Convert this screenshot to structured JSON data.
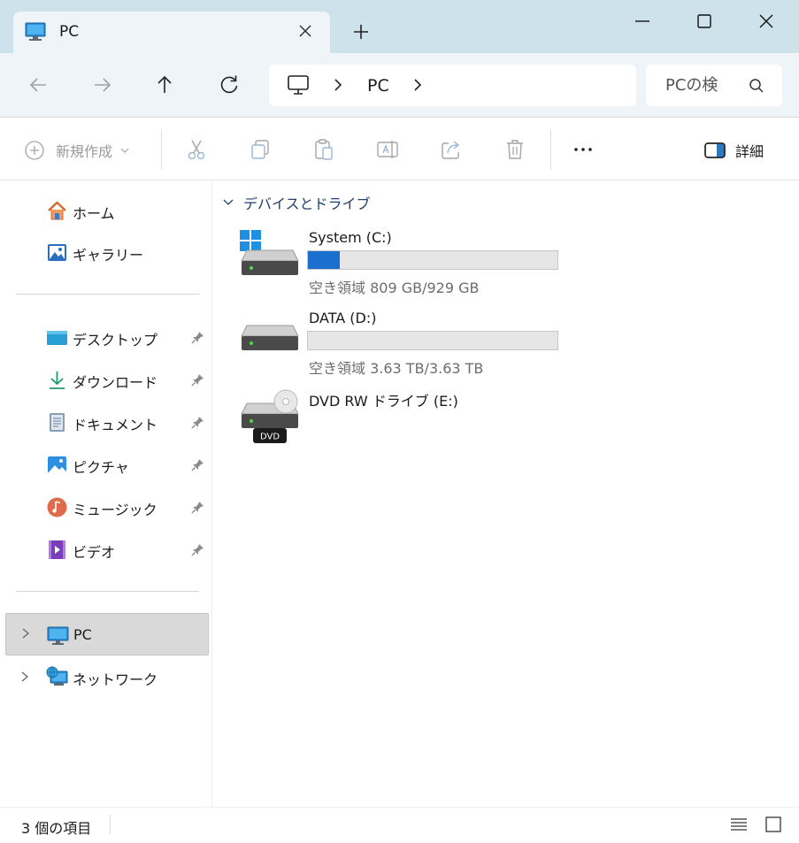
{
  "window": {
    "tab_title": "PC",
    "new_tab_symbol": "+",
    "controls": [
      "minimize-icon",
      "maximize-icon",
      "close-icon"
    ]
  },
  "nav": {
    "breadcrumb": [
      "PC"
    ],
    "search_placeholder": "PCの検"
  },
  "commands": {
    "new_label": "新規作成",
    "details_label": "詳細",
    "icons": [
      "cut-icon",
      "copy-icon",
      "paste-icon",
      "rename-icon",
      "share-icon",
      "delete-icon",
      "more-icon"
    ]
  },
  "sidebar": {
    "quick": [
      {
        "label": "ホーム",
        "icon": "home-icon"
      },
      {
        "label": "ギャラリー",
        "icon": "gallery-icon"
      }
    ],
    "pinned": [
      {
        "label": "デスクトップ",
        "icon": "desktop-icon"
      },
      {
        "label": "ダウンロード",
        "icon": "download-icon"
      },
      {
        "label": "ドキュメント",
        "icon": "document-icon"
      },
      {
        "label": "ピクチャ",
        "icon": "pictures-icon"
      },
      {
        "label": "ミュージック",
        "icon": "music-icon"
      },
      {
        "label": "ビデオ",
        "icon": "video-icon"
      }
    ],
    "tree": [
      {
        "label": "PC",
        "icon": "pc-icon",
        "selected": true
      },
      {
        "label": "ネットワーク",
        "icon": "network-icon",
        "selected": false
      }
    ]
  },
  "content": {
    "group_header": "デバイスとドライブ",
    "drives": [
      {
        "name": "System (C:)",
        "free_text": "空き領域 809 GB/929 GB",
        "used_fraction": 0.129,
        "icon": "system-drive-icon"
      },
      {
        "name": "DATA (D:)",
        "free_text": "空き領域 3.63 TB/3.63 TB",
        "used_fraction": 0.0,
        "icon": "data-drive-icon"
      },
      {
        "name": "DVD RW ドライブ (E:)",
        "badge": "DVD",
        "icon": "dvd-drive-icon"
      }
    ]
  },
  "status": {
    "item_count": "3 個の項目"
  },
  "colors": {
    "titlebar": "#cde2ea",
    "navbar": "#eef4f7",
    "accent": "#1a6fcf",
    "selected": "#d9d9d9"
  }
}
